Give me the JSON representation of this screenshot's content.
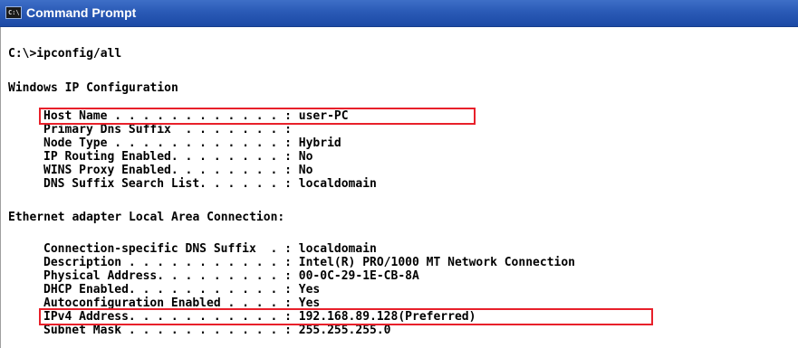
{
  "window": {
    "title": "Command Prompt",
    "icon": "cmd-icon",
    "icon_glyph": "C:\\"
  },
  "console": {
    "command_line": "C:\\>ipconfig/all",
    "header": "Windows IP Configuration",
    "ip_config": [
      "Host Name . . . . . . . . . . . . : user-PC",
      "Primary Dns Suffix  . . . . . . . :",
      "Node Type . . . . . . . . . . . . : Hybrid",
      "IP Routing Enabled. . . . . . . . : No",
      "WINS Proxy Enabled. . . . . . . . : No",
      "DNS Suffix Search List. . . . . . : localdomain"
    ],
    "adapter_header": "Ethernet adapter Local Area Connection:",
    "adapter": [
      "Connection-specific DNS Suffix  . : localdomain",
      "Description . . . . . . . . . . . : Intel(R) PRO/1000 MT Network Connection",
      "Physical Address. . . . . . . . . : 00-0C-29-1E-CB-8A",
      "DHCP Enabled. . . . . . . . . . . : Yes",
      "Autoconfiguration Enabled . . . . : Yes",
      "IPv4 Address. . . . . . . . . . . : 192.168.89.128(Preferred)",
      "Subnet Mask . . . . . . . . . . . : 255.255.255.0"
    ]
  },
  "annotations": {
    "highlight_color": "#e8202a"
  }
}
